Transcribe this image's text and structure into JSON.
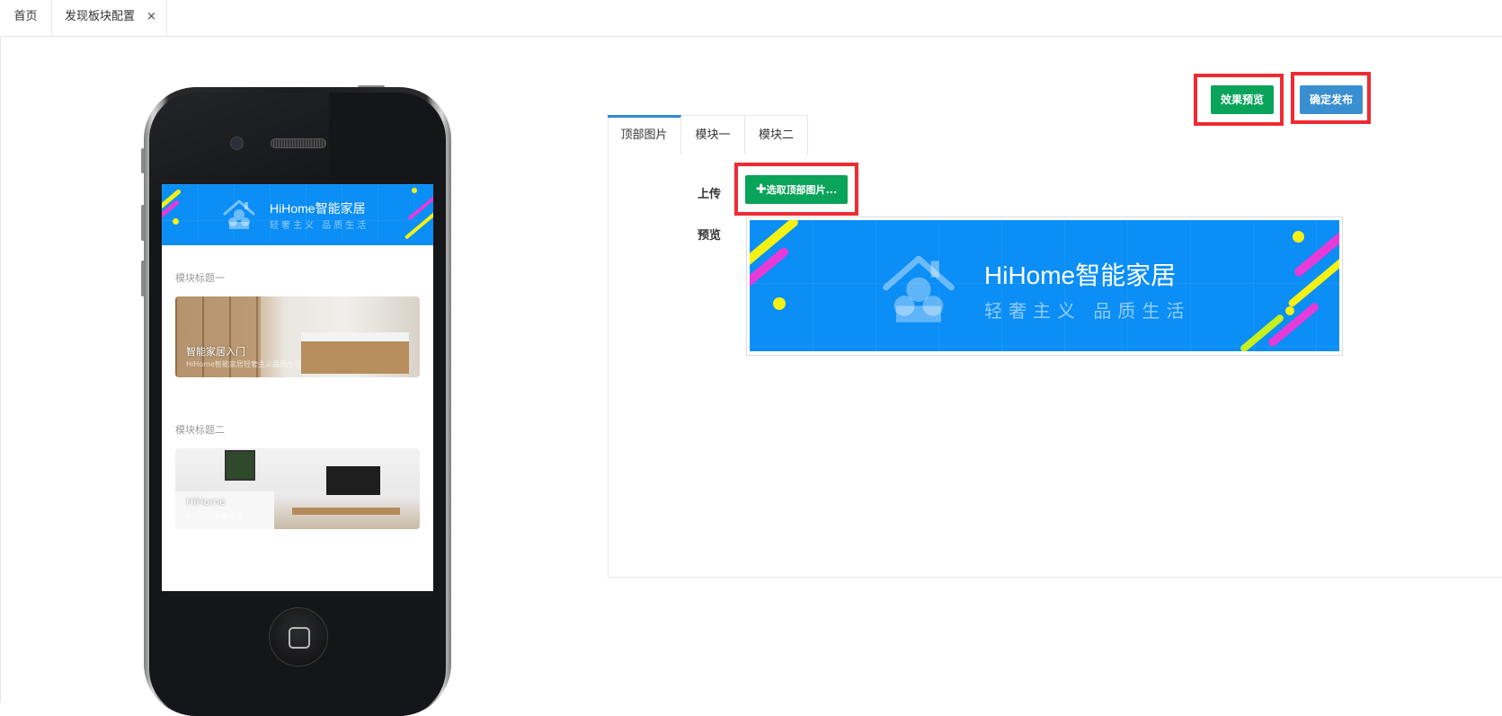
{
  "tabs": {
    "home": "首页",
    "config": "发现板块配置",
    "close": "×"
  },
  "phone_screen": {
    "banner": {
      "brand": "HiHome智能家居",
      "slogan": "轻奢主义  品质生活"
    },
    "module1": {
      "title": "模块标题一",
      "card_caption": "智能家居入门",
      "card_sub": "HiHome智能家居轻奢主义品质生活"
    },
    "module2": {
      "title": "模块标题二",
      "card_caption": "HiHome",
      "card_sub": "HiHome智能家居"
    }
  },
  "actions": {
    "preview_label": "效果预览",
    "publish_label": "确定发布"
  },
  "panel_tabs": [
    "顶部图片",
    "模块一",
    "模块二"
  ],
  "form": {
    "upload_label": "上传",
    "upload_button": "选取顶部图片...",
    "preview_label": "预览"
  },
  "preview_banner": {
    "brand": "HiHome智能家居",
    "slogan": "轻奢主义  品质生活"
  },
  "colors": {
    "brand_blue": "#0b8ef5",
    "green": "#0aa35a",
    "blue_btn": "#3a8fd0",
    "highlight": "#ee2b33"
  }
}
